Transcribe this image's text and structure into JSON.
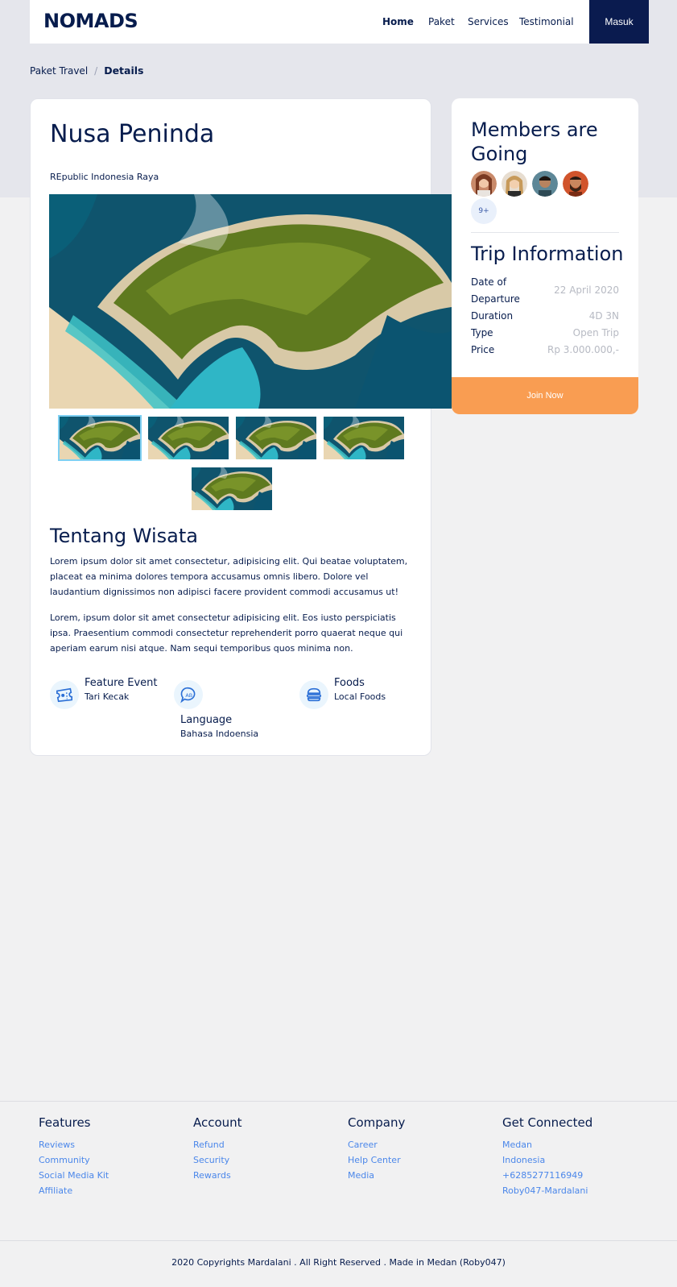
{
  "nav": {
    "logo": "NOMADS",
    "links": [
      "Home",
      "Paket",
      "Services",
      "Testimonial"
    ],
    "login": "Masuk"
  },
  "breadcrumb": {
    "parent": "Paket Travel",
    "separator": "/",
    "current": "Details"
  },
  "detail": {
    "title": "Nusa Peninda",
    "subtitle": "REpublic Indonesia Raya",
    "about_title": "Tentang Wisata",
    "paragraphs": [
      "Lorem ipsum dolor sit amet consectetur, adipisicing elit. Qui beatae voluptatem, placeat ea minima dolores tempora accusamus omnis libero. Dolore vel laudantium dignissimos non adipisci facere provident commodi accusamus ut!",
      "Lorem, ipsum dolor sit amet consectetur adipisicing elit. Eos iusto perspiciatis ipsa. Praesentium commodi consectetur reprehenderit porro quaerat neque qui aperiam earum nisi atque. Nam sequi temporibus quos minima non."
    ],
    "features": [
      {
        "icon": "ticket-icon",
        "title": "Feature Event",
        "value": "Tari Kecak"
      },
      {
        "icon": "chat-bubble-icon",
        "title": "Language",
        "value": "Bahasa Indoensia"
      },
      {
        "icon": "burger-icon",
        "title": "Foods",
        "value": "Local Foods"
      }
    ]
  },
  "sidebar": {
    "members_title": "Members are Going",
    "more_count": "9+",
    "trip_title": "Trip Information",
    "info": [
      {
        "label": "Date of Departure",
        "value": "22 April 2020"
      },
      {
        "label": "Duration",
        "value": "4D 3N"
      },
      {
        "label": "Type",
        "value": "Open Trip"
      },
      {
        "label": "Price",
        "value": "Rp 3.000.000,-"
      }
    ],
    "join": "Join Now"
  },
  "footer": {
    "columns": [
      {
        "title": "Features",
        "links": [
          "Reviews",
          "Community",
          "Social Media Kit",
          "Affiliate"
        ]
      },
      {
        "title": "Account",
        "links": [
          "Refund",
          "Security",
          "Rewards"
        ]
      },
      {
        "title": "Company",
        "links": [
          "Career",
          "Help Center",
          "Media"
        ]
      },
      {
        "title": "Get Connected",
        "links": [
          "Medan",
          "Indonesia",
          "+6285277116949",
          "Roby047-Mardalani"
        ]
      }
    ],
    "copyright": "2020 Copyrights Mardalani . All Right Reserved . Made in Medan (Roby047)"
  },
  "colors": {
    "navy": "#071c4d",
    "accent": "#f99d52",
    "link": "#4b87ea"
  }
}
